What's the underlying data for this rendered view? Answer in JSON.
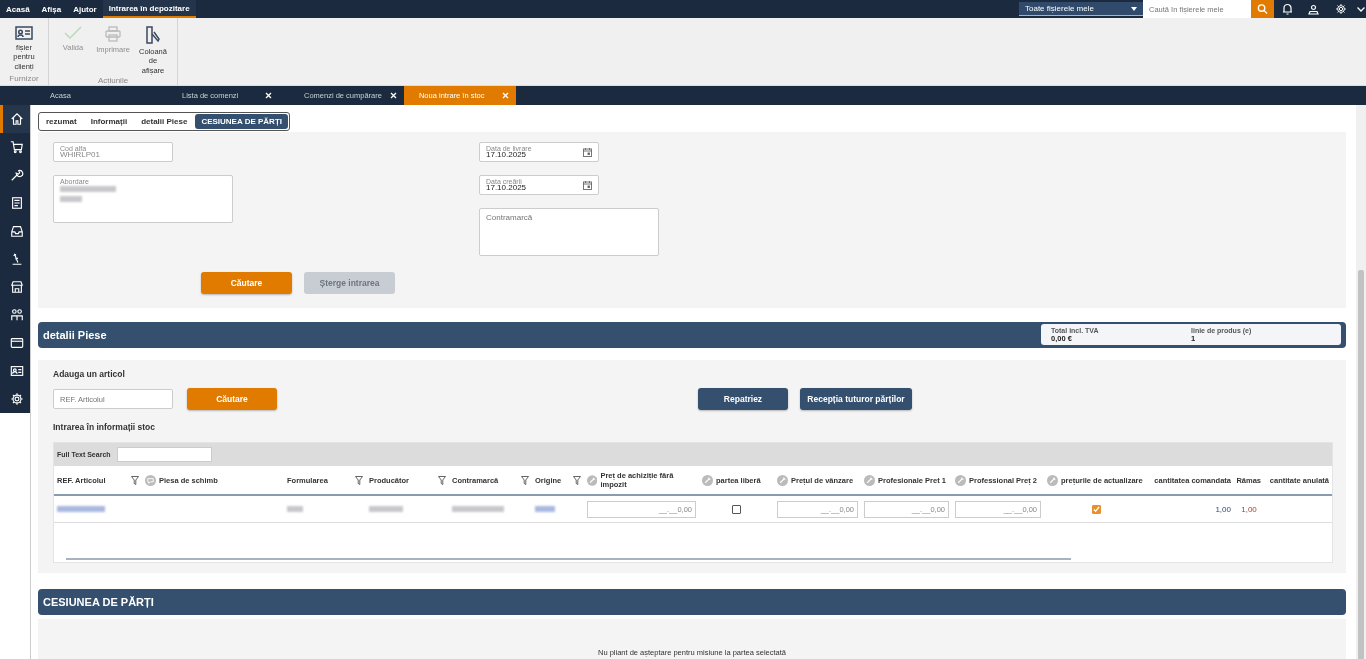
{
  "menu_bar": {
    "items": [
      {
        "label": "Acasă",
        "selected": false
      },
      {
        "label": "Afișa",
        "selected": false
      },
      {
        "label": "Ajutor",
        "selected": false
      },
      {
        "label": "Intrarea în depozitare",
        "selected": true
      }
    ],
    "scope_select": "Toate fișierele mele",
    "search": {
      "placeholder": "Caută în fișierele mele"
    }
  },
  "ribbon": {
    "groups": [
      {
        "label": "Furnizor",
        "buttons": [
          {
            "label": "fișier pentru clienți",
            "kind": "card",
            "disabled": false
          }
        ]
      },
      {
        "label": "Acțiunile",
        "buttons": [
          {
            "label": "Valida",
            "kind": "check",
            "disabled": true
          },
          {
            "label": "Imprimare",
            "kind": "print",
            "disabled": true
          },
          {
            "label": "Coloană de afișare",
            "kind": "column",
            "disabled": false
          }
        ]
      }
    ]
  },
  "doc_tabs": [
    {
      "label": "Acasa",
      "selected": false,
      "closable": false
    },
    {
      "label": "Lista de comenzi",
      "selected": false,
      "closable": true
    },
    {
      "label": "Comenzi de cumpărare",
      "selected": false,
      "closable": true
    },
    {
      "label": "Noua intrare în stoc",
      "selected": true,
      "closable": true
    }
  ],
  "sidebar": {
    "items": [
      {
        "kind": "home",
        "selected": true
      },
      {
        "kind": "cart",
        "selected": false
      },
      {
        "kind": "wrench",
        "selected": false
      },
      {
        "kind": "document",
        "selected": false
      },
      {
        "kind": "tray",
        "selected": false
      },
      {
        "kind": "lever",
        "selected": false
      },
      {
        "kind": "store",
        "selected": false
      },
      {
        "kind": "people",
        "selected": false
      },
      {
        "kind": "card",
        "selected": false
      },
      {
        "kind": "idcard",
        "selected": false
      },
      {
        "kind": "gear",
        "selected": false
      }
    ]
  },
  "section_tabs": [
    {
      "label": "rezumat",
      "selected": false
    },
    {
      "label": "Informații",
      "selected": false
    },
    {
      "label": "detalii Piese",
      "selected": false
    },
    {
      "label": "CESIUNEA DE PĂRȚI",
      "selected": true
    }
  ],
  "header_form": {
    "cod_alfa": {
      "label": "Cod alfa",
      "value": "WHIRLP01"
    },
    "abordare": {
      "label": "Abordare"
    },
    "data_livrare": {
      "label": "Data de livrare",
      "value": "17.10.2025"
    },
    "data_creare": {
      "label": "Data creării",
      "value": "17.10.2025"
    },
    "contramarca": {
      "placeholder": "Contramarcă"
    },
    "buttons": [
      {
        "label": "Căutare",
        "disabled": false
      },
      {
        "label": "Șterge intrarea",
        "disabled": true
      }
    ]
  },
  "parts": {
    "title": "detalii Piese",
    "summary": [
      {
        "label": "Total incl. TVA",
        "value": "0,00 €"
      },
      {
        "label": "linie de produs (e)",
        "value": "1"
      }
    ],
    "add_label": "Adauga un articol",
    "ref_field": {
      "placeholder": "REF. Articolul"
    },
    "search_button": "Căutare",
    "actions": [
      "Repatriez",
      "Recepția tuturor părților"
    ],
    "stock_title": "Intrarea în informații stoc",
    "full_text_search": "Full Text Search",
    "table": {
      "columns": [
        {
          "label": "REF. Articolul",
          "kind": "plain",
          "filter": true
        },
        {
          "label": "Piesa de schimb",
          "kind": "comment",
          "filter": false
        },
        {
          "label": "Formularea",
          "kind": "plain",
          "filter": true
        },
        {
          "label": "Producător",
          "kind": "plain",
          "filter": true
        },
        {
          "label": "Contramarcă",
          "kind": "plain",
          "filter": true
        },
        {
          "label": "Origine",
          "kind": "plain",
          "filter": true
        },
        {
          "label": "Preț de achiziție fără impozit",
          "kind": "editable",
          "filter": false
        },
        {
          "label": "partea liberă",
          "kind": "editable",
          "filter": false
        },
        {
          "label": "Prețul de vânzare",
          "kind": "editable",
          "filter": false
        },
        {
          "label": "Profesionale Pret 1",
          "kind": "editable",
          "filter": false
        },
        {
          "label": "Professional Preț 2",
          "kind": "editable",
          "filter": false
        },
        {
          "label": "prețurile de actualizare",
          "kind": "editable",
          "filter": false
        },
        {
          "label": "cantitatea comandata",
          "kind": "plain",
          "filter": false
        },
        {
          "label": "Rămas",
          "kind": "plain",
          "filter": false
        },
        {
          "label": "cantitate anulată",
          "kind": "plain",
          "filter": false
        }
      ],
      "rows": [
        {
          "cells": [
            {
              "kind": "redacted_link"
            },
            {
              "kind": "empty"
            },
            {
              "kind": "redacted"
            },
            {
              "kind": "redacted"
            },
            {
              "kind": "redacted"
            },
            {
              "kind": "redacted_link"
            },
            {
              "kind": "input",
              "placeholder": "__.__0,00"
            },
            {
              "kind": "checkbox",
              "checked": false
            },
            {
              "kind": "input",
              "placeholder": "__.__0,00"
            },
            {
              "kind": "input",
              "placeholder": "__.__0,00"
            },
            {
              "kind": "input",
              "placeholder": "__.__0,00"
            },
            {
              "kind": "checkbox",
              "checked": true
            },
            {
              "kind": "number",
              "value": "1,00"
            },
            {
              "kind": "remaining",
              "value": "1,00"
            },
            {
              "kind": "empty"
            }
          ]
        }
      ]
    }
  },
  "cession": {
    "title": "CESIUNEA DE PĂRȚI",
    "message": "Nu pliant de așteptare pentru misiune la partea selectată"
  }
}
